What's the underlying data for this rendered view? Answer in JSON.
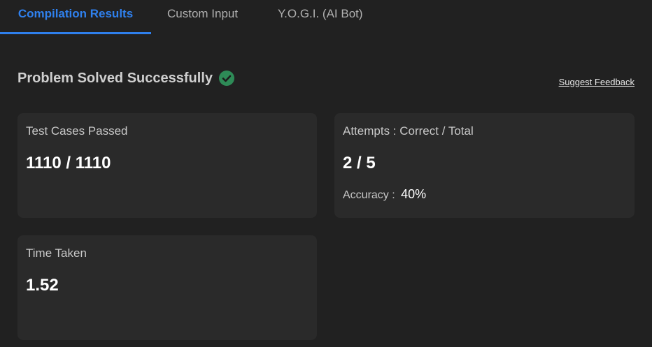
{
  "tabs": [
    {
      "label": "Compilation Results",
      "active": true
    },
    {
      "label": "Custom Input",
      "active": false
    },
    {
      "label": "Y.O.G.I. (AI Bot)",
      "active": false
    }
  ],
  "status": {
    "message": "Problem Solved Successfully",
    "icon": "check-circle-icon",
    "color": "#2e8b57"
  },
  "feedback_link": "Suggest Feedback",
  "cards": {
    "test_cases": {
      "label": "Test Cases Passed",
      "value": "1110 / 1110"
    },
    "attempts": {
      "label": "Attempts : Correct / Total",
      "value": "2 / 5",
      "accuracy_label": "Accuracy :",
      "accuracy_value": "40%"
    },
    "time": {
      "label": "Time Taken",
      "value": "1.52"
    }
  },
  "colors": {
    "accent": "#2f80ed",
    "background": "#212121",
    "card": "#2a2a2a"
  }
}
